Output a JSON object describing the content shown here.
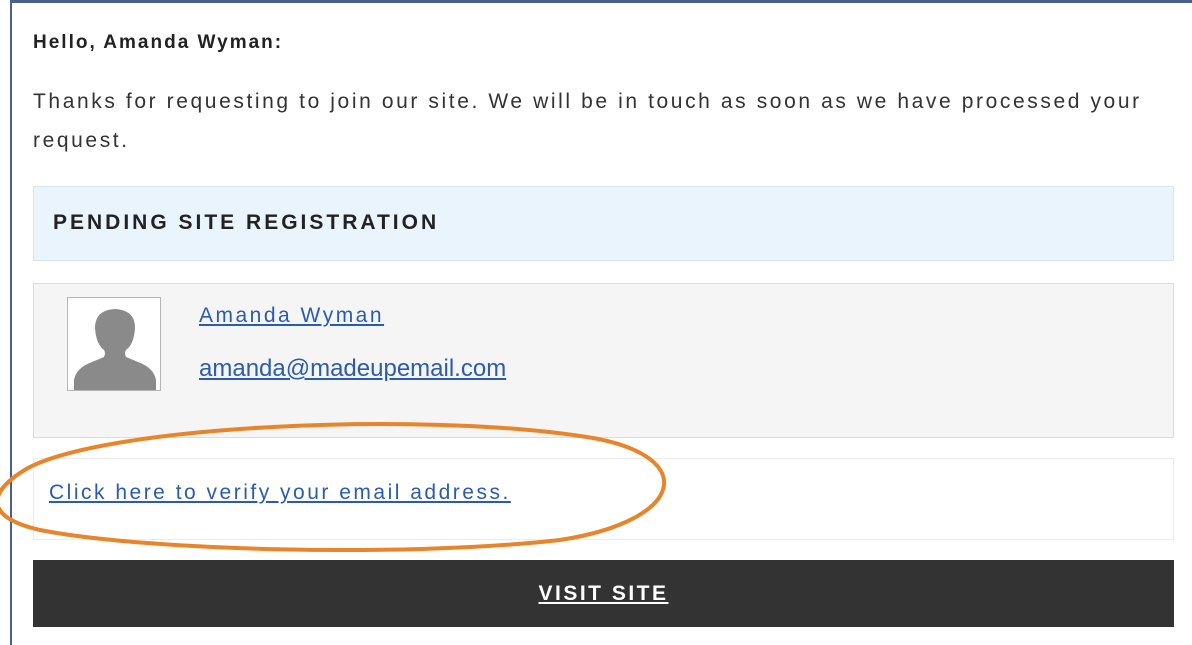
{
  "greeting": "Hello, Amanda Wyman:",
  "intro": "Thanks for requesting to join our site. We will be in touch as soon as we have processed your request.",
  "pending": {
    "title": "PENDING SITE REGISTRATION"
  },
  "user": {
    "name": "Amanda Wyman",
    "email": "amanda@madeupemail.com",
    "avatar_icon": "person-silhouette-icon"
  },
  "verify": {
    "link_label": "Click here to verify your email address."
  },
  "visit": {
    "button_label": "VISIT SITE"
  },
  "colors": {
    "frame": "#4a5f8c",
    "link": "#2b5bb0",
    "pending_bg": "#e9f4fd",
    "card_bg": "#f5f5f5",
    "button_bg": "#333333",
    "highlight": "#e8842a"
  }
}
